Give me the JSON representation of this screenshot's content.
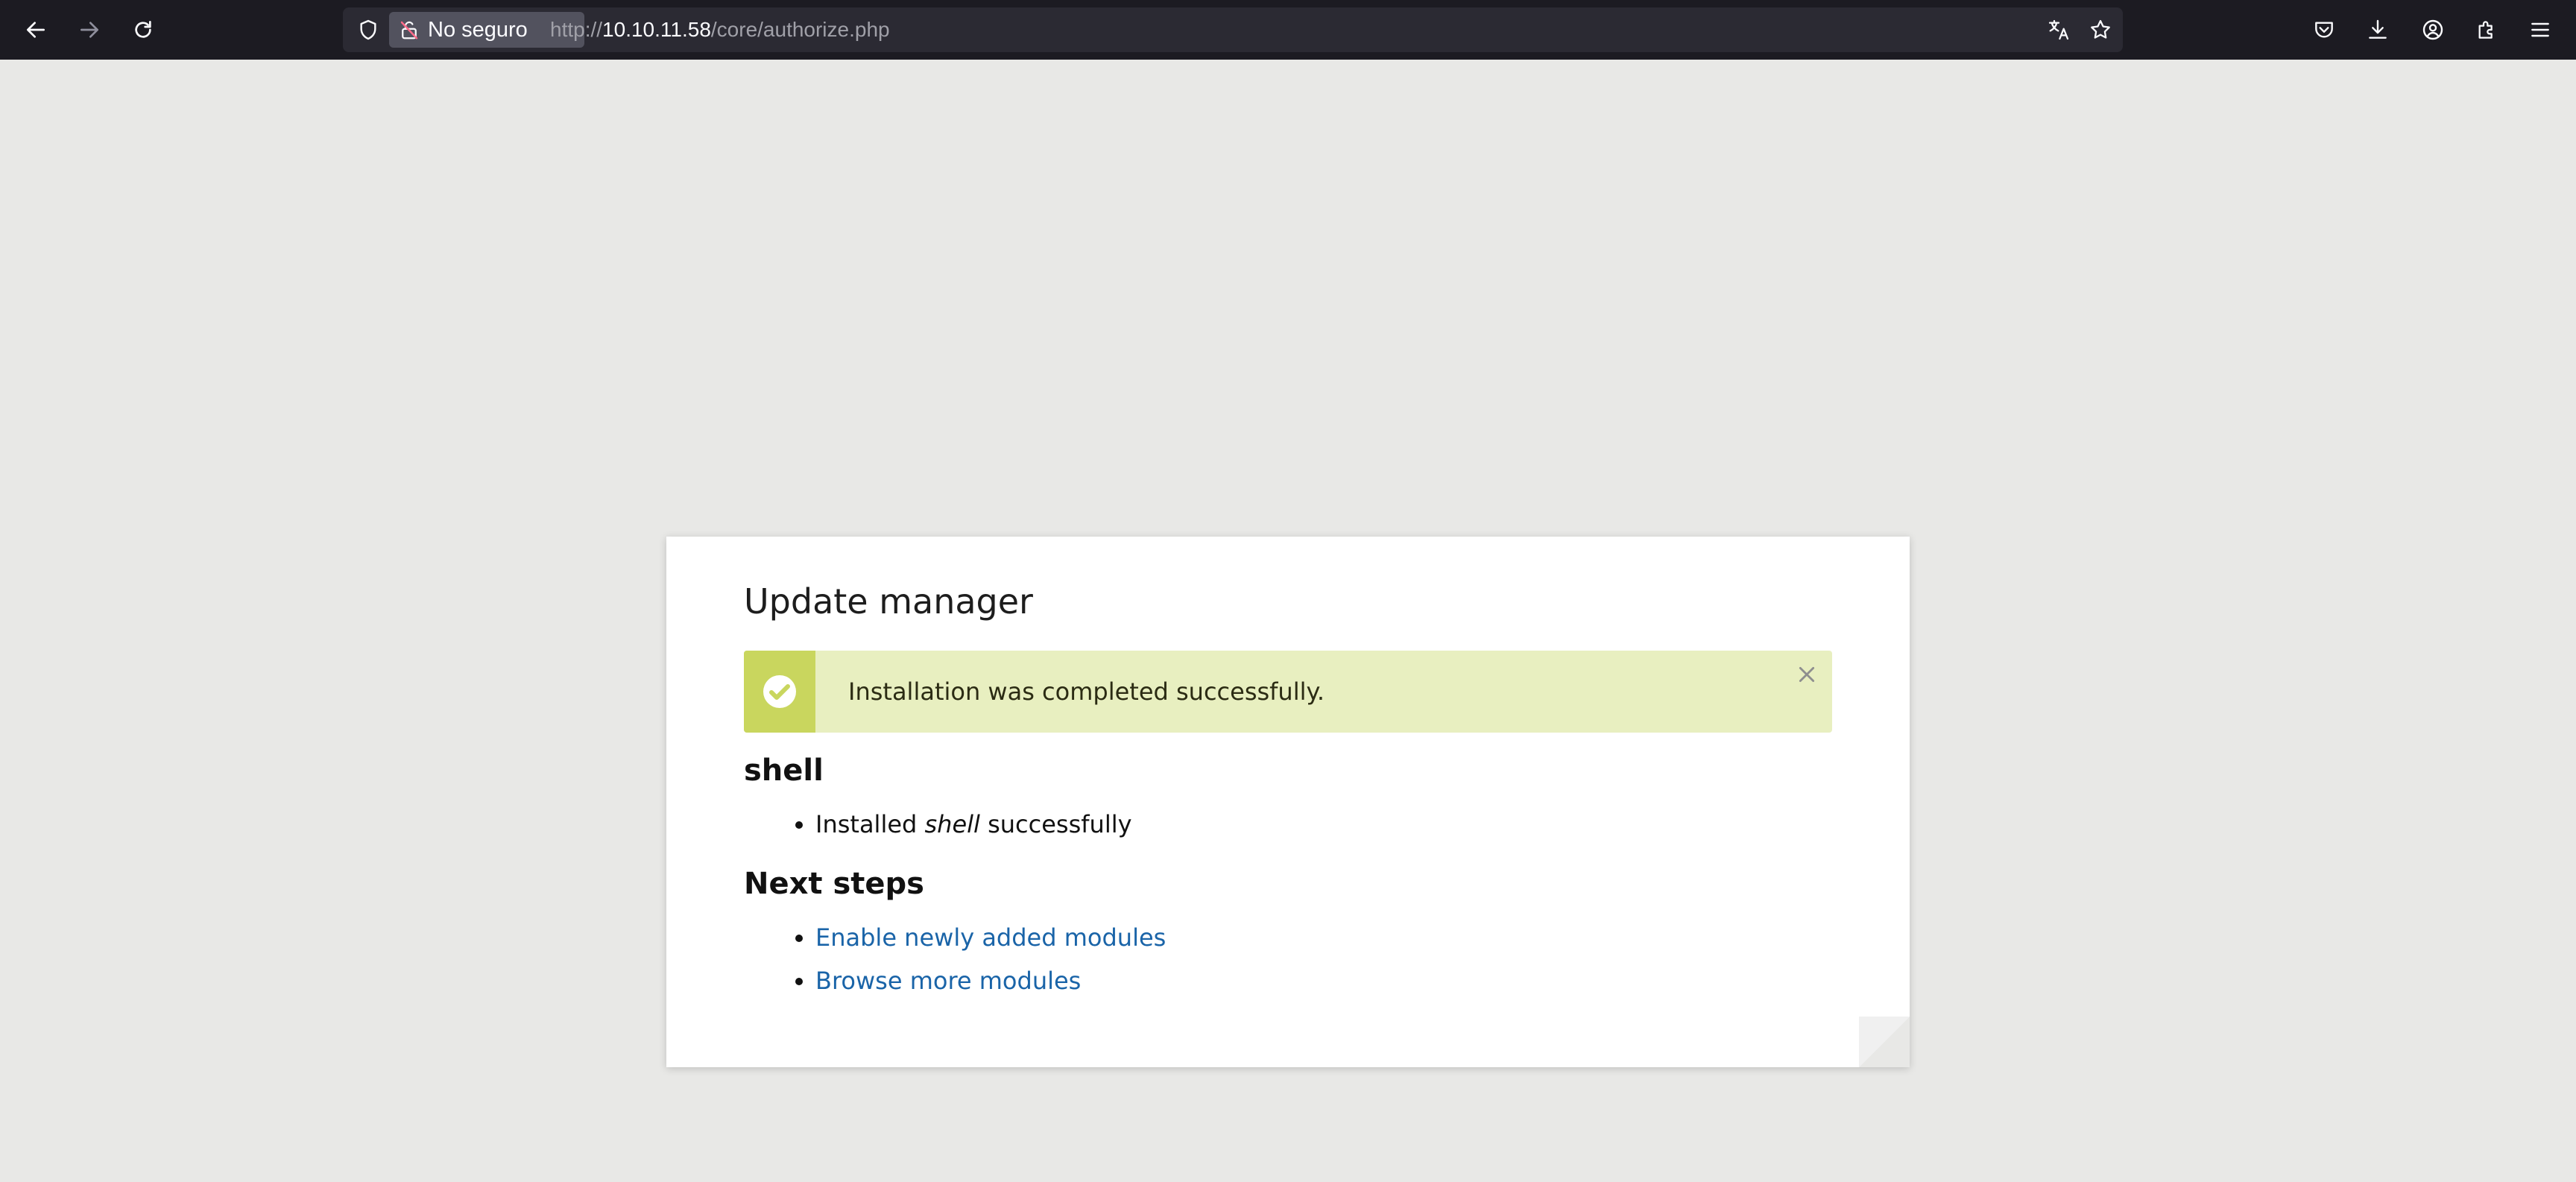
{
  "browser": {
    "back_icon": "arrow-left-icon",
    "forward_icon": "arrow-right-icon",
    "reload_icon": "reload-icon",
    "security_badge": "No seguro",
    "url_prefix": "http://",
    "url_host": "10.10.11.58",
    "url_path": "/core/authorize.php",
    "right_icons": [
      "pocket-icon",
      "download-icon",
      "account-icon",
      "extensions-icon",
      "menu-icon"
    ]
  },
  "page": {
    "title": "Update manager",
    "status_message": "Installation was completed successfully.",
    "module_heading": "shell",
    "module_result_prefix": "Installed ",
    "module_result_name": "shell",
    "module_result_suffix": " successfully",
    "next_steps_heading": "Next steps",
    "next_steps": [
      {
        "label": "Enable newly added modules"
      },
      {
        "label": "Browse more modules"
      }
    ]
  },
  "colors": {
    "toolbar_bg": "#1c1b22",
    "page_bg": "#e8e8e6",
    "status_bg": "#e8efc0",
    "status_icon_bg": "#c9d65e",
    "link": "#1a64a8"
  }
}
